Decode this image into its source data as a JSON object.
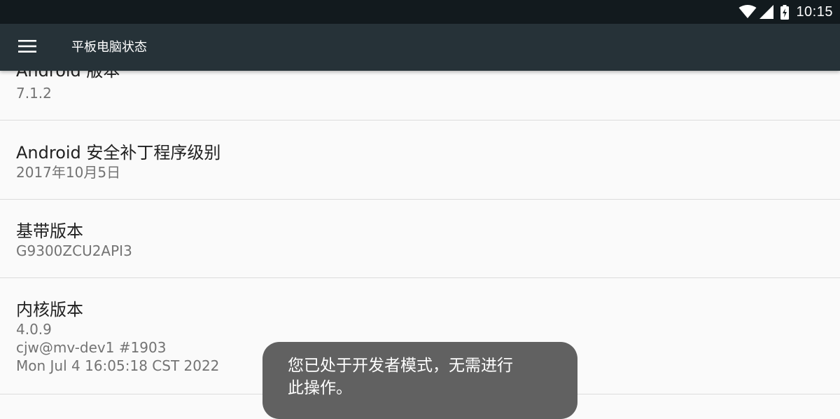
{
  "status_bar": {
    "time": "10:15",
    "icons": [
      "wifi-icon",
      "cell-signal-icon",
      "battery-charging-icon"
    ]
  },
  "app_bar": {
    "menu_icon": "hamburger-menu-icon",
    "title": "平板电脑状态"
  },
  "info_rows": [
    {
      "title": "Android 版本",
      "values": [
        "7.1.2"
      ]
    },
    {
      "title": "Android 安全补丁程序级别",
      "values": [
        "2017年10月5日"
      ]
    },
    {
      "title": "基带版本",
      "values": [
        "G9300ZCU2API3"
      ]
    },
    {
      "title": "内核版本",
      "values": [
        "4.0.9",
        "cjw@mv-dev1 #1903",
        "Mon Jul 4 16:05:18 CST 2022"
      ]
    }
  ],
  "toast": {
    "message_line1": "您已处于开发者模式，无需进行",
    "message_line2": "此操作。"
  },
  "colors": {
    "status_bar_bg": "#121a1e",
    "app_bar_bg": "#263238",
    "page_bg": "#fafafa",
    "toast_bg": "#616161"
  }
}
